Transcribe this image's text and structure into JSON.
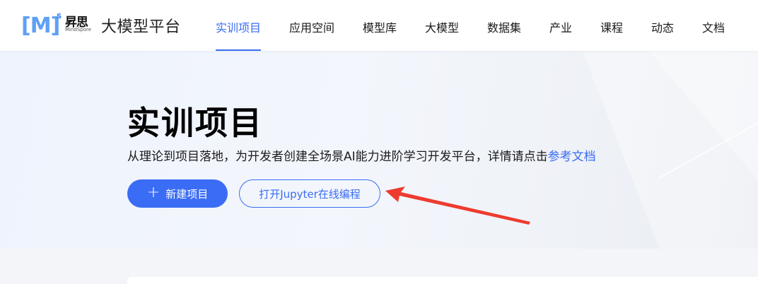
{
  "logo": {
    "bracket_text": "[M]",
    "superscript": "S",
    "cn_name": "昇思",
    "en_name": "MindSpore"
  },
  "site_title": "大模型平台",
  "nav": {
    "items": [
      {
        "label": "实训项目",
        "active": true
      },
      {
        "label": "应用空间"
      },
      {
        "label": "模型库"
      },
      {
        "label": "大模型"
      },
      {
        "label": "数据集"
      },
      {
        "label": "产业"
      },
      {
        "label": "课程"
      },
      {
        "label": "动态"
      },
      {
        "label": "文档"
      }
    ]
  },
  "hero": {
    "title": "实训项目",
    "description": "从理论到项目落地，为开发者创建全场景AI能力进阶学习开发平台，详情请点击",
    "doc_link": "参考文档",
    "new_project_button": "新建项目",
    "jupyter_button": "打开Jupyter在线编程"
  },
  "colors": {
    "accent": "#3a6cf5",
    "arrow": "#ee3b2f"
  }
}
